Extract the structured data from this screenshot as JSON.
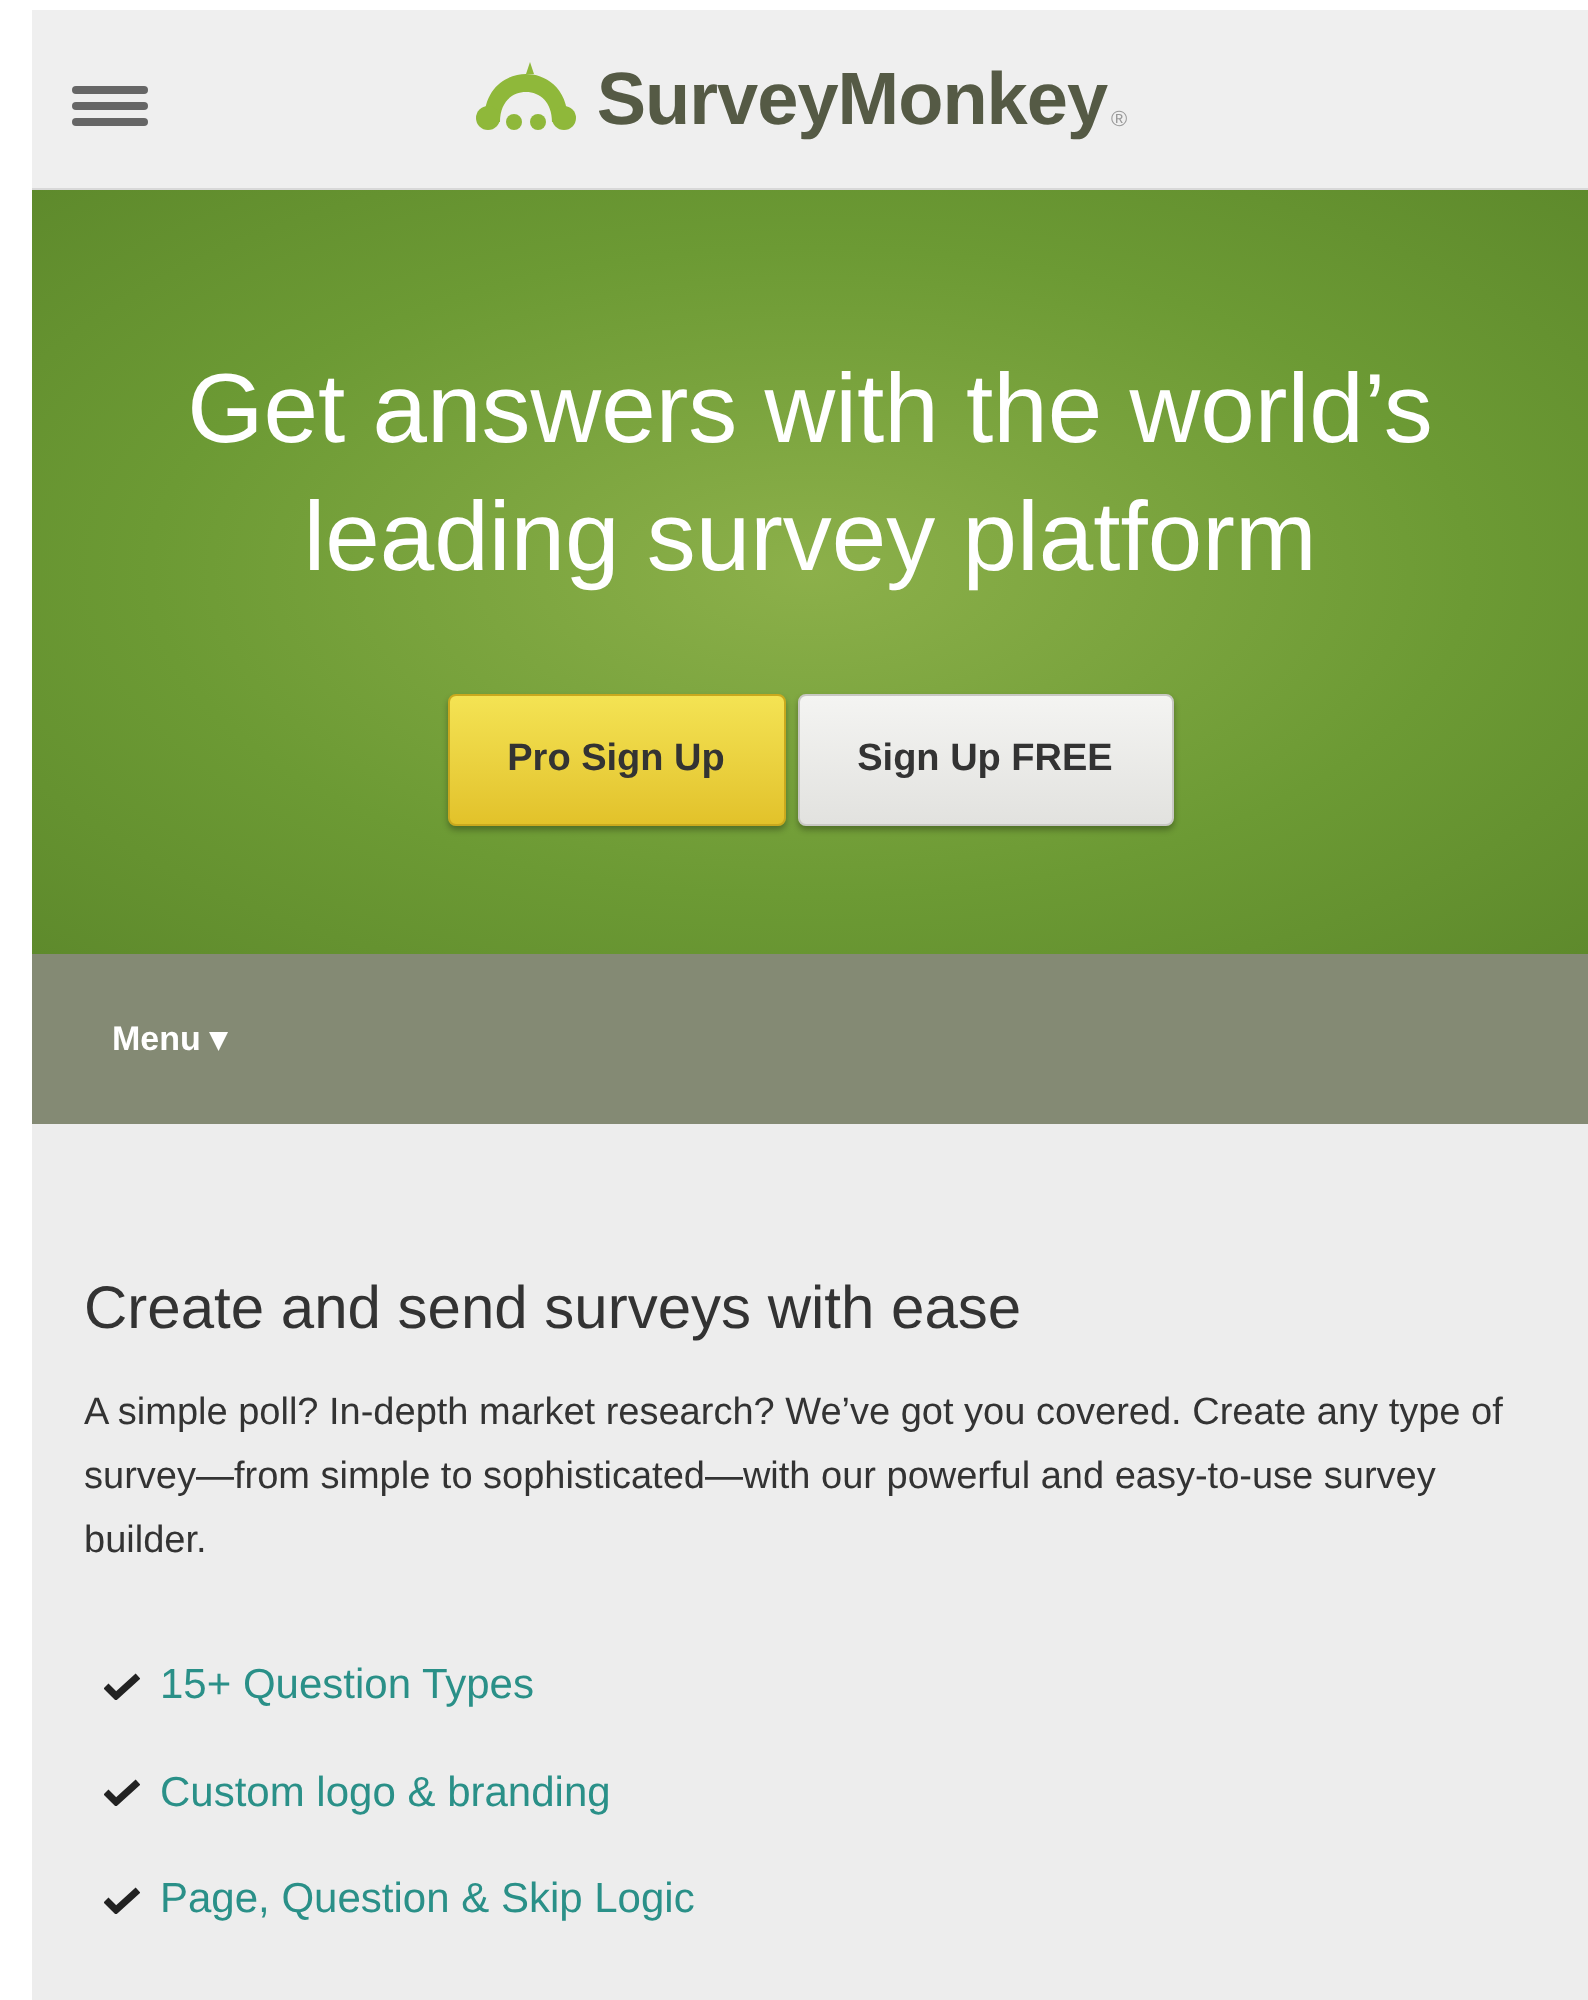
{
  "header": {
    "logo": "SurveyMonkey",
    "logo_mark": "®"
  },
  "hero": {
    "headline": "Get answers with the world’s leading survey platform",
    "buttons": [
      {
        "label": "Pro Sign Up",
        "kind": "primary"
      },
      {
        "label": "Sign Up FREE",
        "kind": "secondary"
      }
    ]
  },
  "menu_bar": {
    "label": "Menu ▾"
  },
  "section": {
    "title": "Create and send surveys with ease",
    "body": "A simple poll? In-depth market research? We’ve got you covered. Create any type of survey—from simple to sophisticated—with our powerful and easy-to-use survey builder.",
    "features": [
      {
        "label": "15+ Question Types"
      },
      {
        "label": "Custom logo & branding"
      },
      {
        "label": "Page, Question & Skip Logic"
      }
    ]
  }
}
